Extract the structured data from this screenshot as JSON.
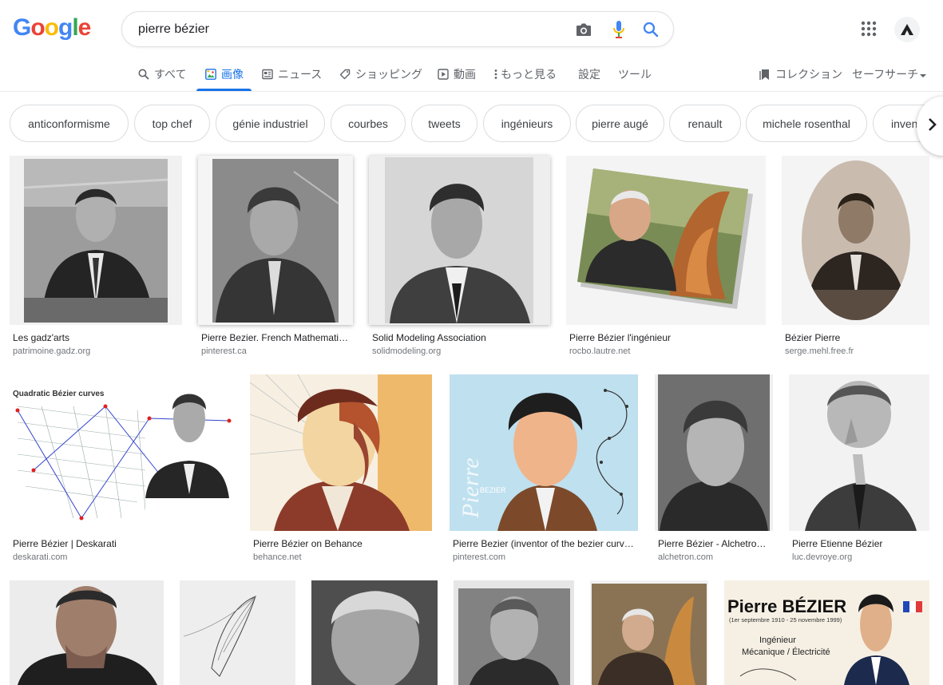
{
  "logo": {
    "letters": [
      "G",
      "o",
      "o",
      "g",
      "l",
      "e"
    ],
    "colors": [
      "#4285F4",
      "#EA4335",
      "#FBBC05",
      "#4285F4",
      "#34A853",
      "#EA4335"
    ]
  },
  "search": {
    "value": "pierre bézier"
  },
  "tabs": [
    {
      "label": "すべて",
      "icon": "search-icon"
    },
    {
      "label": "画像",
      "icon": "images-icon"
    },
    {
      "label": "ニュース",
      "icon": "news-icon"
    },
    {
      "label": "ショッピング",
      "icon": "tag-icon"
    },
    {
      "label": "動画",
      "icon": "play-icon"
    },
    {
      "label": "もっと見る",
      "icon": "more-vert-icon"
    },
    {
      "label": "設定"
    },
    {
      "label": "ツール"
    }
  ],
  "right_links": {
    "collections": "コレクション",
    "safesearch": "セーフサーチ"
  },
  "chips": [
    "anticonformisme",
    "top chef",
    "génie industriel",
    "courbes",
    "tweets",
    "ingénieurs",
    "pierre augé",
    "renault",
    "michele rosenthal",
    "inven"
  ],
  "results": [
    {
      "title": "Les gadz'arts",
      "source": "patrimoine.gadz.org"
    },
    {
      "title": "Pierre Bezier. French Mathemati…",
      "source": "pinterest.ca"
    },
    {
      "title": "Solid Modeling Association",
      "source": "solidmodeling.org"
    },
    {
      "title": "Pierre Bézier l'ingénieur",
      "source": "rocbo.lautre.net"
    },
    {
      "title": "Bézier Pierre",
      "source": "serge.mehl.free.fr"
    },
    {
      "title": "Pierre Bézier | Deskarati",
      "source": "deskarati.com"
    },
    {
      "title": "Pierre Bézier on Behance",
      "source": "behance.net"
    },
    {
      "title": "Pierre Bezier (inventor of the bezier curv…",
      "source": "pinterest.com"
    },
    {
      "title": "Pierre Bézier - Alchetro…",
      "source": "alchetron.com"
    },
    {
      "title": "Pierre Etienne Bézier",
      "source": "luc.devroye.org"
    }
  ],
  "image_text": {
    "deskarati_heading": "Quadratic Bézier curves",
    "pierre_word": "Pierre",
    "bezier_word": "BEZIER",
    "poster_name": "Pierre BÉZIER",
    "poster_dates": "(1er septembre 1910 - 25 novembre 1999)",
    "poster_role1": "Ingénieur",
    "poster_role2": "Mécanique / Électricité"
  }
}
